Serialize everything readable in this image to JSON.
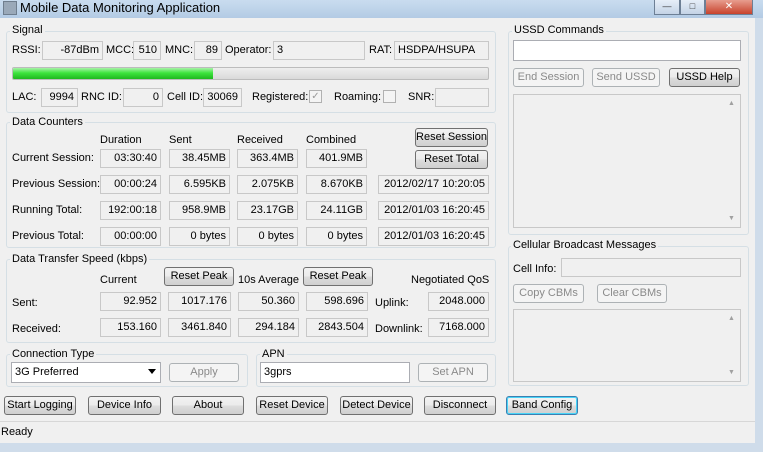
{
  "window": {
    "title": "Mobile Data Monitoring Application",
    "controls": {
      "minimize": "—",
      "maximize": "□",
      "close": "✕"
    }
  },
  "signal": {
    "title": "Signal",
    "rssi_label": "RSSI:",
    "rssi": "-87dBm",
    "mcc_label": "MCC:",
    "mcc": "510",
    "mnc_label": "MNC:",
    "mnc": "89",
    "operator_label": "Operator:",
    "operator": "3",
    "rat_label": "RAT:",
    "rat": "HSDPA/HSUPA",
    "strength_fraction": 0.42,
    "lac_label": "LAC:",
    "lac": "9994",
    "rnc_label": "RNC ID:",
    "rnc": "0",
    "cell_label": "Cell ID:",
    "cell": "30069",
    "registered_label": "Registered:",
    "registered_mark": "✓",
    "roaming_label": "Roaming:",
    "snr_label": "SNR:",
    "snr": ""
  },
  "counters": {
    "title": "Data Counters",
    "headers": [
      "Duration",
      "Sent",
      "Received",
      "Combined"
    ],
    "reset_session": "Reset Session",
    "reset_total": "Reset Total",
    "rows": [
      {
        "label": "Current Session:",
        "duration": "03:30:40",
        "sent": "38.45MB",
        "received": "363.4MB",
        "combined": "401.9MB",
        "date": ""
      },
      {
        "label": "Previous Session:",
        "duration": "00:00:24",
        "sent": "6.595KB",
        "received": "2.075KB",
        "combined": "8.670KB",
        "date": "2012/02/17 10:20:05"
      },
      {
        "label": "Running Total:",
        "duration": "192:00:18",
        "sent": "958.9MB",
        "received": "23.17GB",
        "combined": "24.11GB",
        "date": "2012/01/03 16:20:45"
      },
      {
        "label": "Previous Total:",
        "duration": "00:00:00",
        "sent": "0 bytes",
        "received": "0 bytes",
        "combined": "0 bytes",
        "date": "2012/01/03 16:20:45"
      }
    ]
  },
  "speed": {
    "title": "Data Transfer Speed (kbps)",
    "current_label": "Current",
    "avg_label": "10s Average",
    "qos_label": "Negotiated QoS",
    "reset_peak": "Reset Peak",
    "sent_label": "Sent:",
    "received_label": "Received:",
    "sent_current": "92.952",
    "sent_peak": "1017.176",
    "sent_avg": "50.360",
    "sent_avg_peak": "598.696",
    "recv_current": "153.160",
    "recv_peak": "3461.840",
    "recv_avg": "294.184",
    "recv_avg_peak": "2843.504",
    "uplink_label": "Uplink:",
    "uplink": "2048.000",
    "downlink_label": "Downlink:",
    "downlink": "7168.000"
  },
  "connection": {
    "title": "Connection Type",
    "selected": "3G Preferred",
    "apply": "Apply"
  },
  "apn": {
    "title": "APN",
    "value": "3gprs",
    "set": "Set APN"
  },
  "ussd": {
    "title": "USSD Commands",
    "input": "",
    "end": "End Session",
    "send": "Send USSD",
    "help": "USSD Help"
  },
  "cbm": {
    "title": "Cellular Broadcast Messages",
    "cell_info_label": "Cell Info:",
    "cell_info": "",
    "copy": "Copy CBMs",
    "clear": "Clear CBMs"
  },
  "toolbar": {
    "start_logging": "Start Logging",
    "device_info": "Device Info",
    "about": "About",
    "reset_device": "Reset Device",
    "detect_device": "Detect Device",
    "disconnect": "Disconnect",
    "band_config": "Band Config"
  },
  "status": {
    "text": "Ready"
  }
}
